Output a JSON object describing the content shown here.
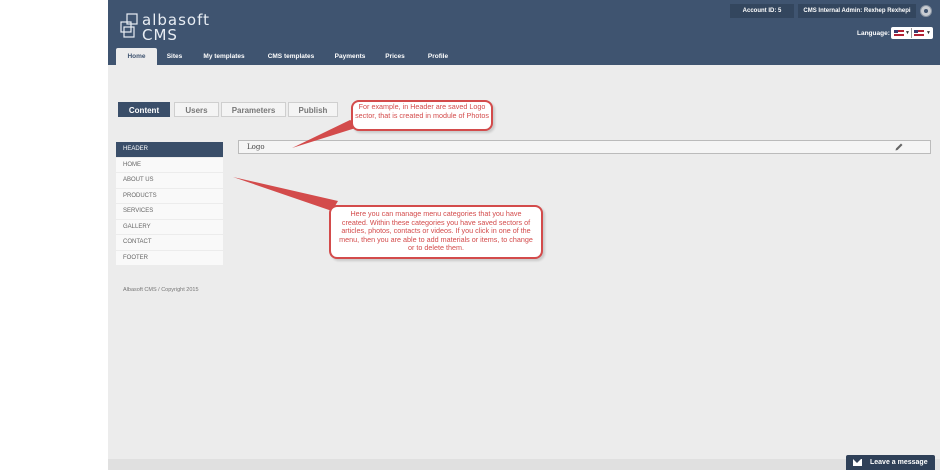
{
  "brand": {
    "name": "albasoft",
    "product": "CMS"
  },
  "topbar": {
    "account_id": "Account ID: 5",
    "admin": "CMS Internal Admin: Rexhep Rexhepi",
    "language_label": "Language:"
  },
  "nav": [
    "Home",
    "Sites",
    "My templates",
    "CMS templates",
    "Payments",
    "Prices",
    "Profile"
  ],
  "section_tabs": [
    "Content",
    "Users",
    "Parameters",
    "Publish"
  ],
  "menu": [
    "HEADER",
    "HOME",
    "ABOUT US",
    "PRODUCTS",
    "SERVICES",
    "GALLERY",
    "CONTACT",
    "FOOTER"
  ],
  "logo_row_label": "Logo",
  "copyright": "Albasoft CMS / Copyright 2015",
  "leave_message": "Leave a message",
  "callouts": {
    "header_note": "For example, in Header are saved Logo sector, that is created in module of Photos",
    "menu_note": "Here you can manage menu categories that you have created. Within these categories you have saved sectors of articles, photos, contacts or videos. If you click in one of the menu, then you are able to add materials or items, to change or to delete them."
  },
  "colors": {
    "header_bg": "#3f5470",
    "accent_dark": "#3a4e69",
    "callout_red": "#d34b4b",
    "content_bg": "#ececec"
  },
  "icons": [
    "settings-icon",
    "us-flag-icon",
    "pencil-icon",
    "mail-icon"
  ]
}
